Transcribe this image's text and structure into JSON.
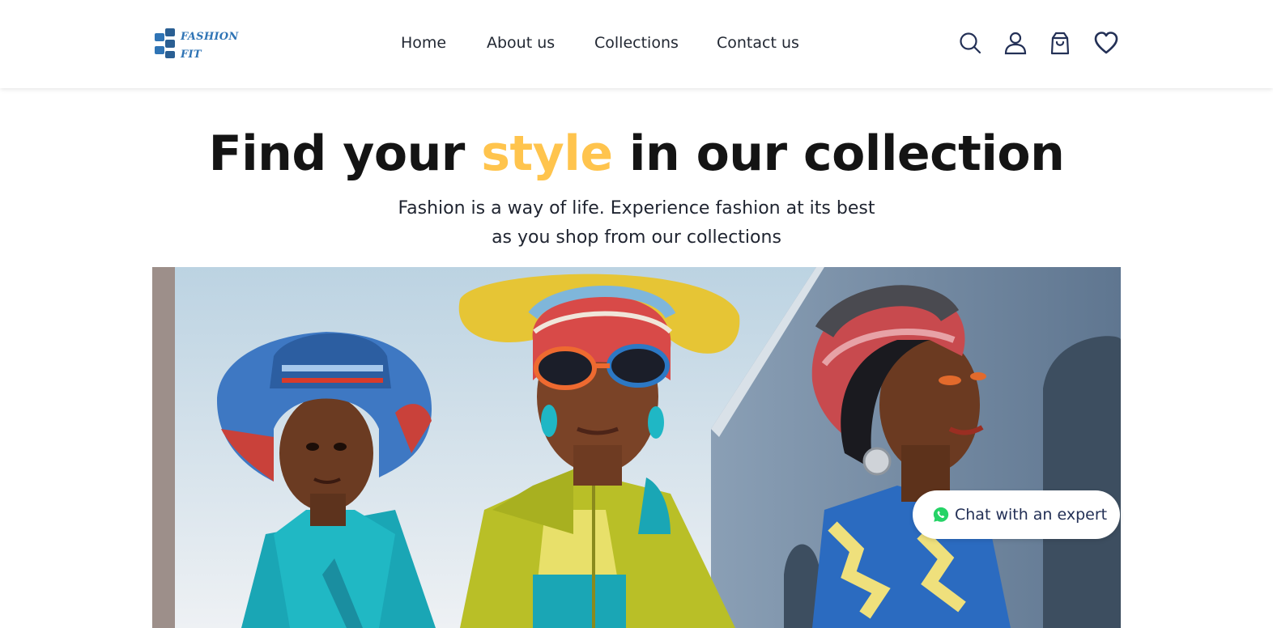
{
  "header": {
    "logo": {
      "line1": "FASHION",
      "line2": "FIT",
      "color": "#2f74b5"
    },
    "nav": [
      {
        "label": "Home"
      },
      {
        "label": "About us"
      },
      {
        "label": "Collections"
      },
      {
        "label": "Contact us"
      }
    ],
    "icons": [
      "search-icon",
      "user-icon",
      "shopping-bag-icon",
      "heart-icon"
    ]
  },
  "hero": {
    "title_before": "Find your ",
    "title_accent": "style",
    "title_after": " in our collection",
    "accent_color": "#ffc44d",
    "subtitle": "Fashion is a way of life. Experience fashion at its best as you shop from our collections"
  },
  "chat": {
    "label": "Chat with an expert",
    "icon": "whatsapp-icon",
    "icon_color": "#25d366"
  }
}
